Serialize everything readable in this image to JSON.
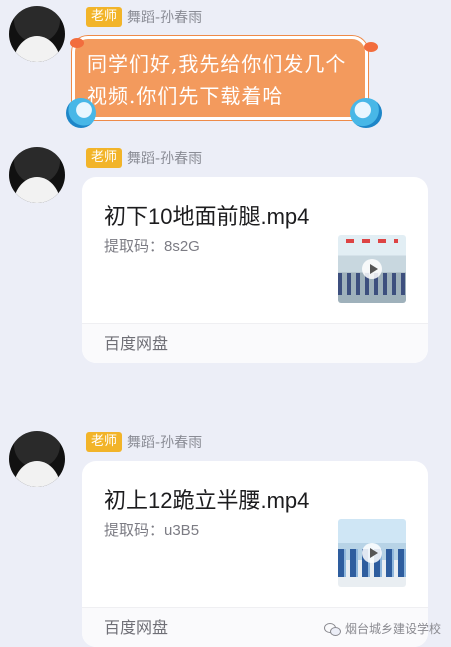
{
  "messages": [
    {
      "role": "老师",
      "sender": "舞蹈-孙春雨",
      "sticker_text": "同学们好,我先给你们发几个视频.你们先下载着哈"
    },
    {
      "role": "老师",
      "sender": "舞蹈-孙春雨",
      "file_name": "初下10地面前腿.mp4",
      "extract_code": "提取码：8s2G",
      "source": "百度网盘"
    },
    {
      "role": "老师",
      "sender": "舞蹈-孙春雨",
      "file_name": "初上12跪立半腰.mp4",
      "extract_code": "提取码：u3B5",
      "source": "百度网盘"
    }
  ],
  "watermark": "烟台城乡建设学校",
  "icons": {
    "watermark_icon": "wechat-icon",
    "thumbnail_overlay": "play-icon"
  },
  "colors": {
    "background": "#eceef7",
    "role_badge": "#f2b429",
    "sticker": "#f39a5d"
  }
}
